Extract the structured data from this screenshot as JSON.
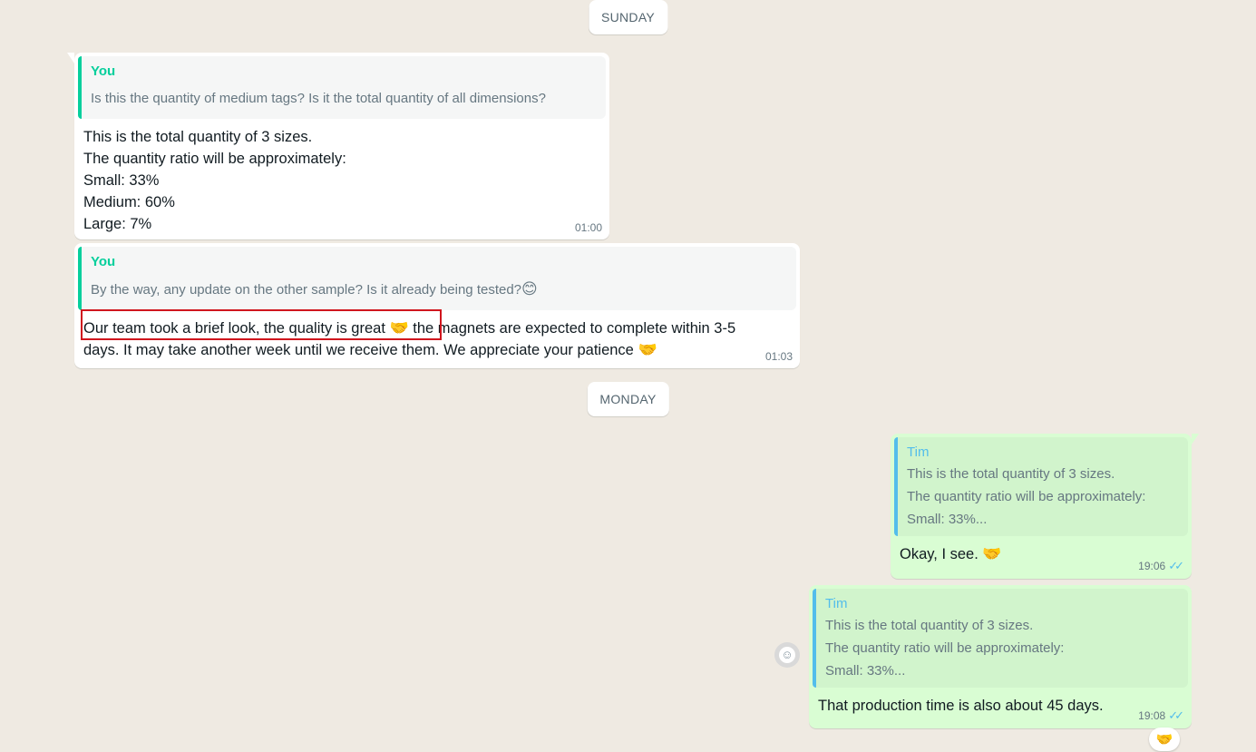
{
  "days": {
    "sunday": "SUNDAY",
    "monday": "MONDAY"
  },
  "messages": [
    {
      "quote_author": "You",
      "quote_text": "Is this the quantity of medium tags? Is it the total quantity of all dimensions?",
      "text": "This is the total quantity of 3 sizes.\nThe quantity ratio will be approximately:\nSmall: 33%\nMedium: 60%\nLarge: 7%",
      "time": "01:00"
    },
    {
      "quote_author": "You",
      "quote_text": "By the way, any update on the other sample? Is it already being tested?",
      "quote_emoji": "😊",
      "text_highlighted": "Our team took a brief look, the quality is great",
      "text_rest": "the magnets are expected to complete within 3-5 days. It may take another week until we receive them. We appreciate your patience",
      "emoji": "🤝",
      "time": "01:03"
    },
    {
      "quote_author": "Tim",
      "quote_text": "This is the total quantity of 3 sizes.\nThe quantity ratio will be approximately:\nSmall: 33%...",
      "text": "Okay, I see.",
      "emoji": "🤝",
      "time": "19:06",
      "ticks": "✓✓"
    },
    {
      "quote_author": "Tim",
      "quote_text": "This is the total quantity of 3 sizes.\nThe quantity ratio will be approximately:\nSmall: 33%...",
      "text": "That production time is also about 45 days.",
      "time": "19:08",
      "ticks": "✓✓",
      "reaction": "🤝",
      "reaction_button_icon": "☺"
    }
  ],
  "colors": {
    "chat_background": "#efeae2",
    "incoming_bubble": "#ffffff",
    "outgoing_bubble": "#d9fdd3",
    "you_accent": "#06cf9c",
    "tim_accent": "#53bdeb",
    "highlight_border": "#d0161e"
  }
}
